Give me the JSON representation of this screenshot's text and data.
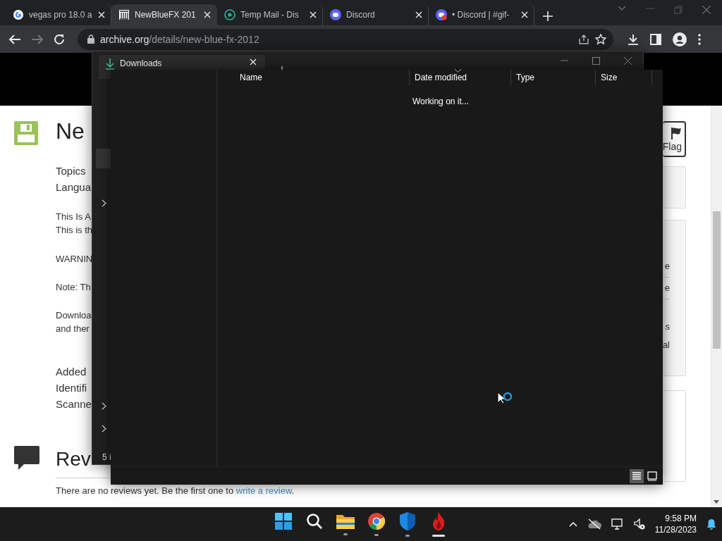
{
  "browser": {
    "tabs": [
      {
        "title": "vegas pro 18.0 a",
        "selected": false
      },
      {
        "title": "NewBlueFX 201",
        "selected": true
      },
      {
        "title": "Temp Mail - Dis",
        "selected": false
      },
      {
        "title": "Discord",
        "selected": false
      },
      {
        "title": "• Discord | #gif-",
        "selected": false
      }
    ],
    "address": {
      "domain": "archive.org",
      "path": "/details/new-blue-fx-2012"
    }
  },
  "page": {
    "title": "Ne",
    "topics": [
      "Topics",
      "Langua"
    ],
    "description": [
      [
        "This Is A",
        "This is th"
      ],
      [
        "WARNIN"
      ],
      [
        "Note: Th"
      ],
      [
        "Downloa",
        "and ther"
      ]
    ],
    "metadata": [
      "Added",
      "Identifi",
      "Scanne"
    ],
    "reviews": {
      "heading": "Rev",
      "text": "There are no reviews yet. Be the first one to ",
      "link": "write a review",
      "end": "."
    },
    "flag": "Flag",
    "sidebar_texts": [
      "e",
      "e",
      "s",
      "al"
    ]
  },
  "explorer_back": {
    "tab": "Downloads",
    "status": "5 i"
  },
  "explorer": {
    "columns": [
      {
        "label": "Name",
        "sorted": false
      },
      {
        "label": "Date modified",
        "sorted": true
      },
      {
        "label": "Type",
        "sorted": false
      },
      {
        "label": "Size",
        "sorted": false
      }
    ],
    "message": "Working on it...",
    "views": [
      {
        "selected": true
      },
      {
        "selected": false
      }
    ]
  },
  "taskbar": {
    "apps": [
      {
        "open": false,
        "active": false
      },
      {
        "open": false,
        "active": false
      },
      {
        "open": true,
        "active": false
      },
      {
        "open": true,
        "active": false
      },
      {
        "open": true,
        "active": false
      },
      {
        "open": true,
        "active": true
      }
    ],
    "time": "9:58 PM",
    "date": "11/28/2023"
  }
}
